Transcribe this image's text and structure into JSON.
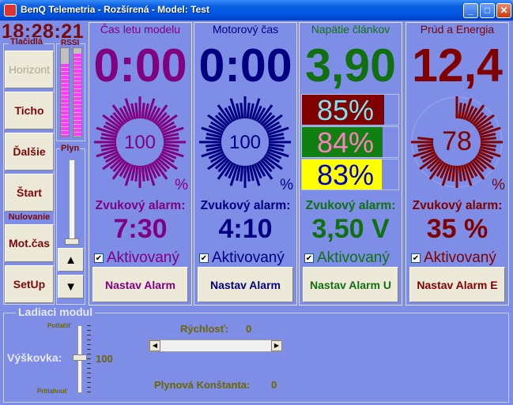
{
  "window": {
    "title": "BenQ Telemetria - Rozšírená  -  Model:  Test",
    "controls": {
      "minimize": "_",
      "maximize": "□",
      "close": "✕"
    }
  },
  "clock": "18:28:21",
  "buttons_group": {
    "title": "Tlačidlá",
    "buttons": [
      "Horizont",
      "Ticho",
      "Ďalšie",
      "Štart",
      "Mot.čas",
      "SetUp"
    ],
    "nulovanie_label": "Nulovanie"
  },
  "rssi": {
    "label": "RSSI",
    "levels": [
      0.82,
      0.94
    ]
  },
  "plyn": {
    "label": "Plyn",
    "level": 0.05
  },
  "panels": {
    "flight_time": {
      "title": "Čas letu modelu",
      "value": "0:00",
      "gauge_value": "100",
      "gauge_unit": "%",
      "alarm_label": "Zvukový alarm:",
      "alarm_value": "7:30",
      "checkbox_label": "Aktivovaný",
      "checkbox_mark": "✔",
      "button_label": "Nastav Alarm",
      "color": "#800080"
    },
    "motor_time": {
      "title": "Motorový čas",
      "value": "0:00",
      "gauge_value": "100",
      "gauge_unit": "%",
      "alarm_label": "Zvukový alarm:",
      "alarm_value": "4:10",
      "checkbox_label": "Aktivovaný",
      "checkbox_mark": "✔",
      "button_label": "Nastav Alarm",
      "color": "#000080"
    },
    "cell_voltage": {
      "title": "Napätie článkov",
      "value": "3,90",
      "cells": [
        {
          "label": "85%",
          "fill": 0.85,
          "bg": "#800000",
          "fg": "#7fe3f0"
        },
        {
          "label": "84%",
          "fill": 0.84,
          "bg": "#108010",
          "fg": "#ff80c0"
        },
        {
          "label": "83%",
          "fill": 0.83,
          "bg": "#ffff00",
          "fg": "#0000c0"
        }
      ],
      "alarm_label": "Zvukový alarm:",
      "alarm_value": "3,50 V",
      "checkbox_label": "Aktivovaný",
      "checkbox_mark": "✔",
      "button_label": "Nastav Alarm U",
      "color": "#107010"
    },
    "current_energy": {
      "title": "Prúd a Energia",
      "value": "12,4",
      "gauge_value": "78",
      "gauge_unit": "%",
      "alarm_label": "Zvukový alarm:",
      "alarm_value": "35 %",
      "checkbox_label": "Aktivovaný",
      "checkbox_mark": "✔",
      "button_label": "Nastav Alarm E",
      "color": "#800000"
    }
  },
  "ladiaci": {
    "title": "Ladiaci modul",
    "potlacit": "Potlačiť",
    "pritiahnut": "Pritiahnuť",
    "vyskovka_label": "Výškovka:",
    "vyskovka_value": "100",
    "rychlost_label": "Rýchlosť:",
    "rychlost_value": "0",
    "plynova_label": "Plynová Konštanta:",
    "plynova_value": "0",
    "scroll_left": "◀",
    "scroll_right": "▶"
  },
  "arrows": {
    "up": "▲",
    "down": "▼"
  }
}
